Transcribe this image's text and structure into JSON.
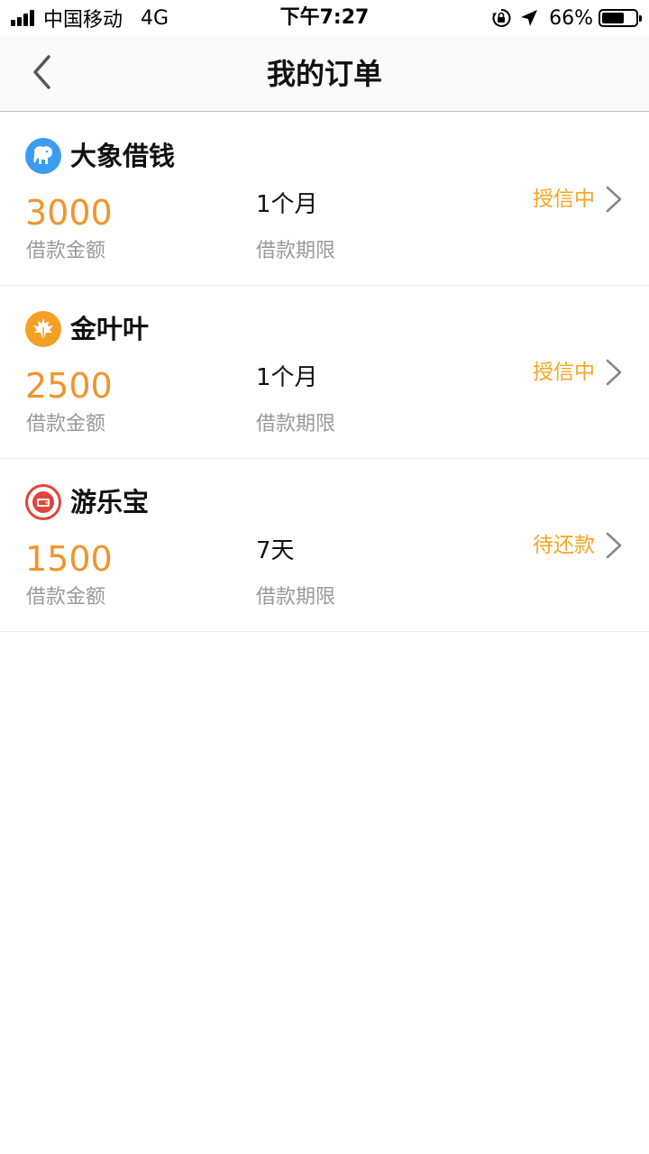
{
  "status_bar": {
    "carrier": "中国移动",
    "network": "4G",
    "time": "下午7:27",
    "battery": "66%",
    "battery_level": 0.66,
    "icons": [
      "signal-icon",
      "orientation-lock-icon",
      "location-arrow-icon",
      "battery-icon"
    ]
  },
  "nav": {
    "title": "我的订单",
    "back_icon": "chevron-left-icon"
  },
  "colors": {
    "amount": "#f0952b",
    "status": "#f5a623",
    "label": "#999999"
  },
  "orders": [
    {
      "merchant": "大象借钱",
      "logo_icon": "elephant-icon",
      "amount": "3000",
      "amount_label": "借款金额",
      "term": "1个月",
      "term_label": "借款期限",
      "status": "授信中"
    },
    {
      "merchant": "金叶叶",
      "logo_icon": "maple-leaf-icon",
      "amount": "2500",
      "amount_label": "借款金额",
      "term": "1个月",
      "term_label": "借款期限",
      "status": "授信中"
    },
    {
      "merchant": "游乐宝",
      "logo_icon": "wallet-icon",
      "amount": "1500",
      "amount_label": "借款金额",
      "term": "7天",
      "term_label": "借款期限",
      "status": "待还款"
    }
  ]
}
